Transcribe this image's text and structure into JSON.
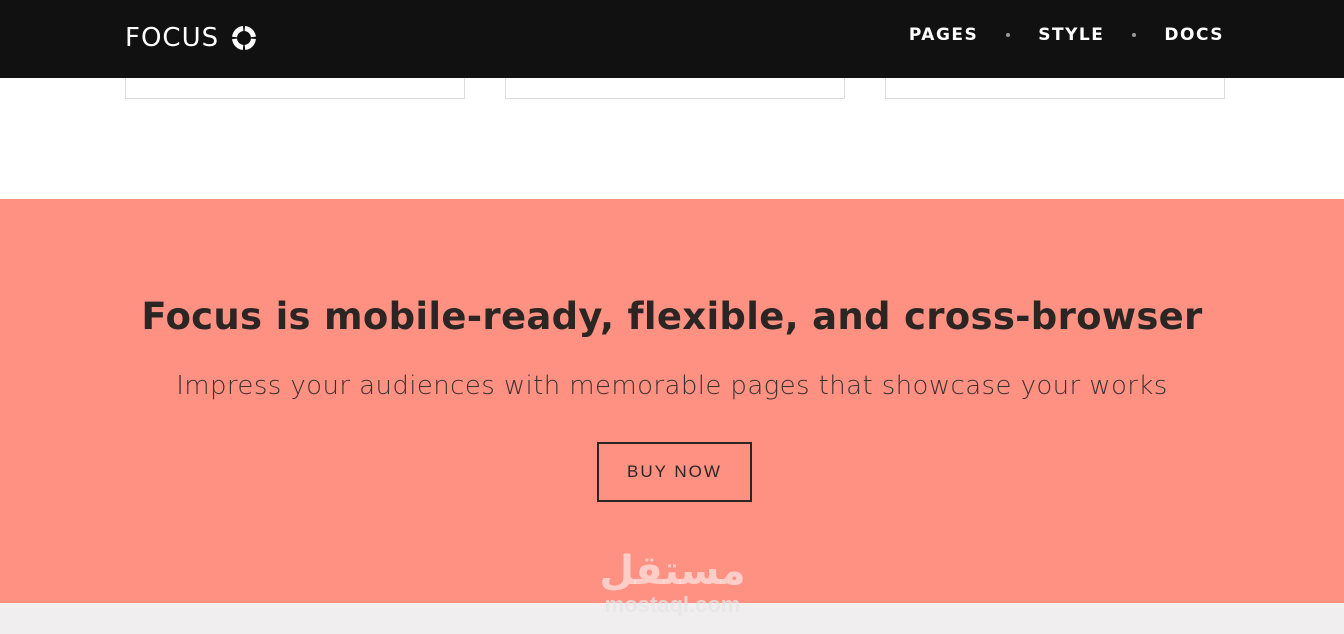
{
  "header": {
    "brand": "FOCUS",
    "nav": [
      {
        "label": "PAGES"
      },
      {
        "label": "STYLE"
      },
      {
        "label": "DOCS"
      }
    ]
  },
  "cta": {
    "title": "Focus is mobile-ready, flexible, and cross-browser",
    "subtitle": "Impress your audiences with memorable pages that showcase your works",
    "button_label": "BUY NOW"
  },
  "watermark": {
    "arabic": "مستقل",
    "latin": "mostaql.com"
  },
  "colors": {
    "navbar": "#111111",
    "cta_background": "#ff9183",
    "text_dark": "#2b2624"
  }
}
